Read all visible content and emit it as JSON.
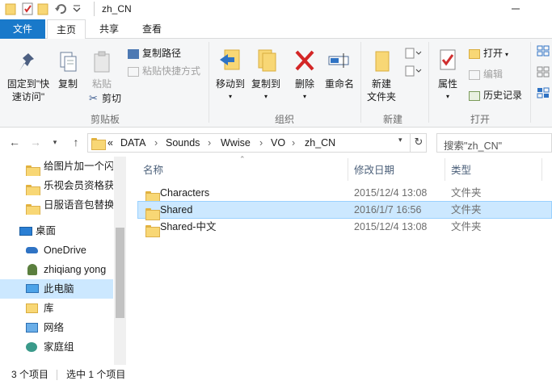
{
  "window": {
    "title": "zh_CN"
  },
  "tabs": [
    {
      "label": "文件"
    },
    {
      "label": "主页"
    },
    {
      "label": "共享"
    },
    {
      "label": "查看"
    }
  ],
  "ribbon": {
    "clipboard": {
      "pin_label_1": "固定到\"快",
      "pin_label_2": "速访问\"",
      "copy": "复制",
      "paste": "粘贴",
      "copy_path": "复制路径",
      "paste_shortcut": "粘贴快捷方式",
      "cut": "剪切",
      "group": "剪贴板"
    },
    "organize": {
      "move_to": "移动到",
      "copy_to": "复制到",
      "delete": "删除",
      "rename": "重命名",
      "group": "组织"
    },
    "new": {
      "new_folder_1": "新建",
      "new_folder_2": "文件夹",
      "group": "新建"
    },
    "open": {
      "properties": "属性",
      "open": "打开",
      "edit": "编辑",
      "history": "历史记录",
      "group": "打开"
    }
  },
  "address": {
    "overflow": "«",
    "crumbs": [
      "DATA",
      "Sounds",
      "Wwise",
      "VO",
      "zh_CN"
    ],
    "search_placeholder": "搜索\"zh_CN\""
  },
  "nav": {
    "items": [
      {
        "label": "给图片加一个闪"
      },
      {
        "label": "乐视会员资格获"
      },
      {
        "label": "日服语音包替换"
      },
      {
        "label": "桌面"
      },
      {
        "label": "OneDrive"
      },
      {
        "label": "zhiqiang yong"
      },
      {
        "label": "此电脑"
      },
      {
        "label": "库"
      },
      {
        "label": "网络"
      },
      {
        "label": "家庭组"
      }
    ]
  },
  "table": {
    "headers": {
      "name": "名称",
      "date": "修改日期",
      "type": "类型"
    },
    "rows": [
      {
        "name": "Characters",
        "date": "2015/12/4 13:08",
        "type": "文件夹"
      },
      {
        "name": "Shared",
        "date": "2016/1/7 16:56",
        "type": "文件夹"
      },
      {
        "name": "Shared-中文",
        "date": "2015/12/4 13:08",
        "type": "文件夹"
      }
    ]
  },
  "status": {
    "count": "3 个项目",
    "selected": "选中 1 个项目"
  },
  "colors": {
    "file_tab": "#1979ca",
    "selection": "#cce8ff",
    "folder": "#f8d775"
  }
}
